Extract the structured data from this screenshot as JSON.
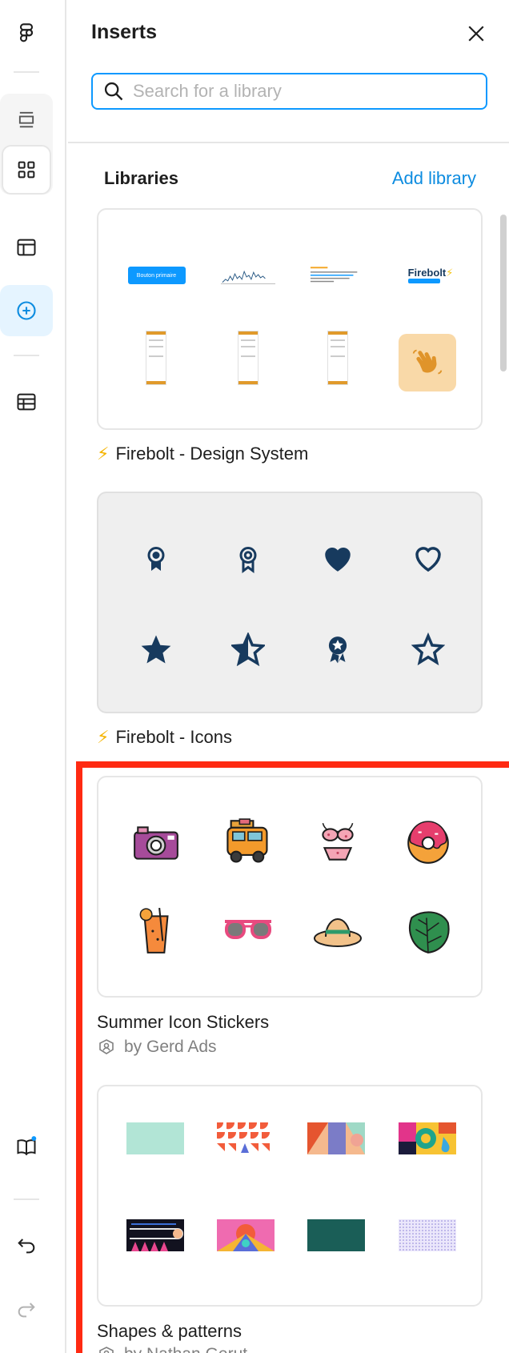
{
  "rail": {
    "items": [
      {
        "name": "figma-logo-icon"
      },
      {
        "name": "pages-icon"
      },
      {
        "name": "assets-icon"
      },
      {
        "name": "layout-icon"
      },
      {
        "name": "insert-icon"
      },
      {
        "name": "table-icon"
      },
      {
        "name": "docs-book-icon"
      },
      {
        "name": "undo-icon"
      },
      {
        "name": "redo-icon"
      }
    ]
  },
  "panel": {
    "title": "Inserts",
    "search_placeholder": "Search for a library",
    "section_title": "Libraries",
    "add_library": "Add library"
  },
  "libraries": [
    {
      "name": "Firebolt - Design System",
      "prefix_icon": "lightning-icon",
      "thumb_labels": [
        "Bouton primaire",
        "Firebolt"
      ]
    },
    {
      "name": "Firebolt - Icons",
      "prefix_icon": "lightning-icon",
      "icons": [
        "award-icon",
        "award-outline-icon",
        "heart-filled-icon",
        "heart-outline-icon",
        "star-filled-icon",
        "star-half-icon",
        "award-star-icon",
        "star-outline-icon"
      ]
    },
    {
      "name": "Summer Icon Stickers",
      "author": "by Gerd Ads",
      "icons": [
        "camera-sticker-icon",
        "van-sticker-icon",
        "bikini-sticker-icon",
        "donut-sticker-icon",
        "cocktail-sticker-icon",
        "sunglasses-sticker-icon",
        "sunhat-sticker-icon",
        "leaf-sticker-icon"
      ]
    },
    {
      "name": "Shapes & patterns",
      "author": "by Nathan Gerut"
    }
  ],
  "colors": {
    "accent": "#0d99ff",
    "link": "#0d8ce0",
    "highlight": "#ff2a12",
    "icon_navy": "#173a5e"
  }
}
